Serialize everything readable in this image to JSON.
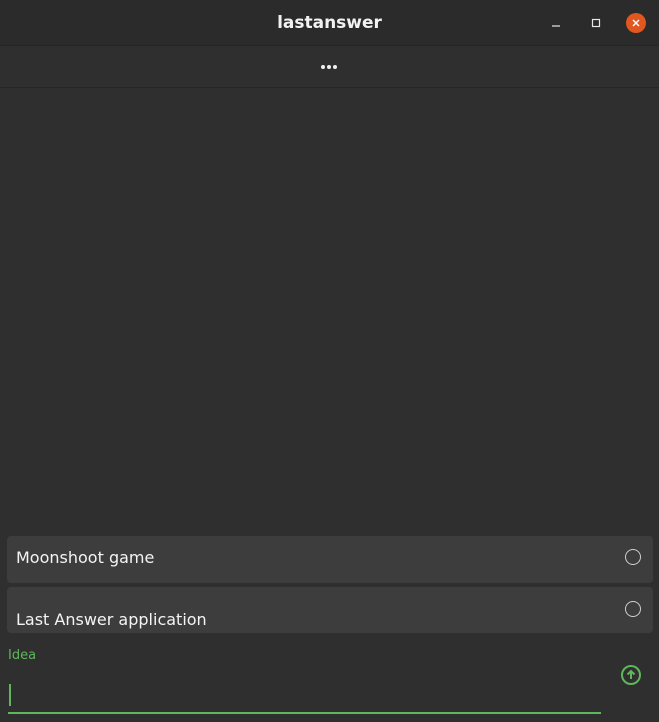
{
  "window": {
    "title": "lastanswer"
  },
  "toolbar": {
    "more_icon": "more-horizontal-icon"
  },
  "list": {
    "items": [
      {
        "label": "Moonshoot game",
        "selected": false
      },
      {
        "label": "Last Answer application",
        "selected": false
      }
    ]
  },
  "input": {
    "label": "Idea",
    "value": ""
  },
  "colors": {
    "accent": "#5fb65b",
    "close_button": "#e2561f",
    "background": "#2f2f2f",
    "item_background": "#3d3d3d"
  }
}
